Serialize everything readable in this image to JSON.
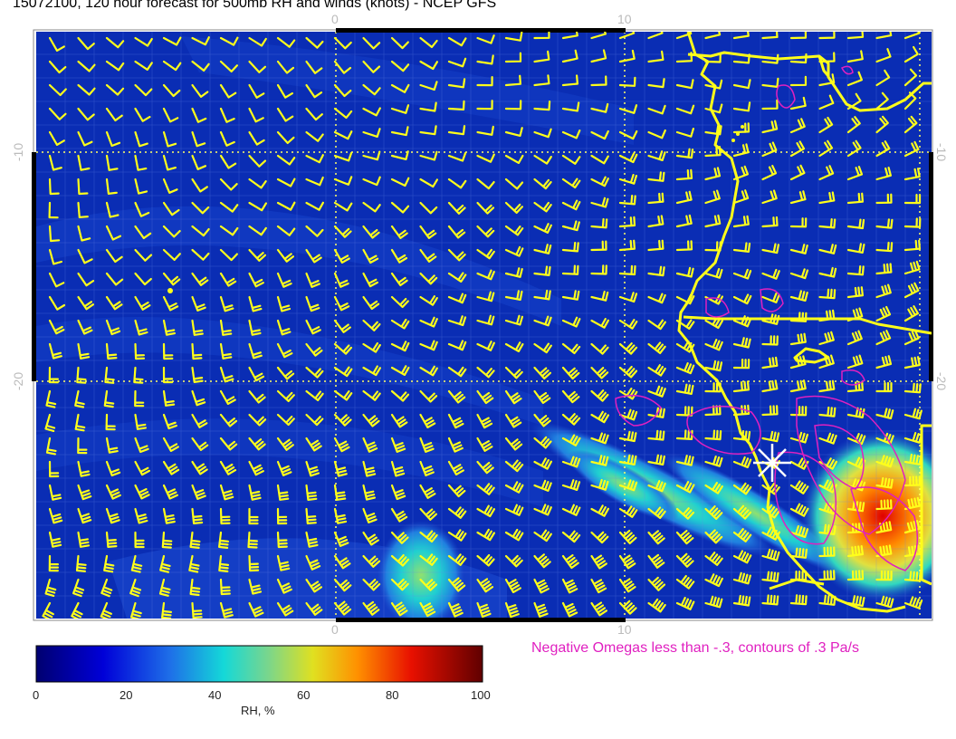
{
  "title": "15072100, 120 hour forecast for 500mb RH and winds (knots) - NCEP GFS",
  "omega_note": "Negative Omegas less than -.3, contours of .3 Pa/s",
  "axis": {
    "top_ticks": [
      "0",
      "10"
    ],
    "bottom_ticks": [
      "0",
      "10"
    ],
    "left_ticks": [
      "-10",
      "-20"
    ],
    "right_ticks": [
      "-10",
      "-20"
    ]
  },
  "colorbar": {
    "title": "RH, %",
    "ticks": [
      "0",
      "20",
      "40",
      "60",
      "80",
      "100"
    ],
    "min": 0,
    "max": 100
  },
  "colors": {
    "background_field": "#0a2db4",
    "wind_barbs": "#ffff1a",
    "coastline": "#ffff1a",
    "omega_contours": "#e020c0",
    "grid": "#ffff66"
  },
  "map": {
    "storm_marker_icon": "asterisk-icon",
    "features": [
      "coastline",
      "state-borders",
      "wind-barbs",
      "rh-shading",
      "omega-contours"
    ]
  }
}
